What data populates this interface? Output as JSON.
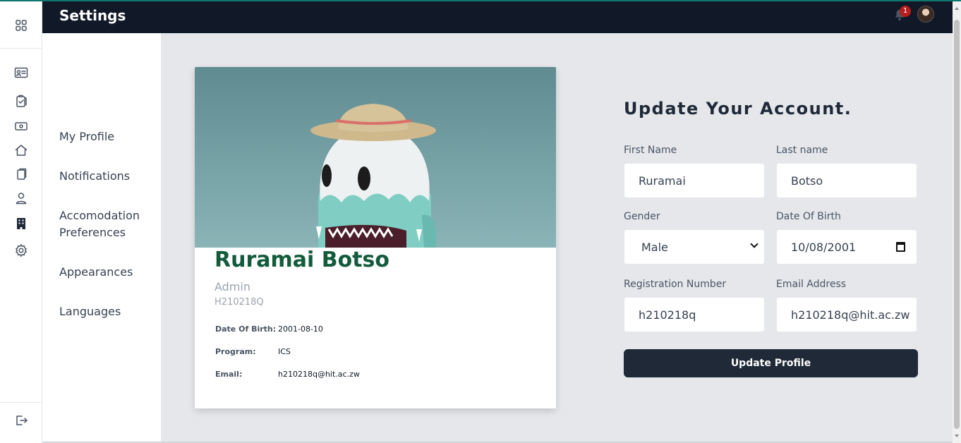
{
  "header": {
    "title": "Settings",
    "notification_count": "1"
  },
  "menu": {
    "items": [
      {
        "label": "My Profile"
      },
      {
        "label": "Notifications"
      },
      {
        "label": "Accomodation Preferences"
      },
      {
        "label": "Appearances"
      },
      {
        "label": "Languages"
      }
    ]
  },
  "rail_icons": [
    "grid-icon",
    "id-card-icon",
    "clipboard-check-icon",
    "cash-icon",
    "home-icon",
    "documents-icon",
    "user-icon",
    "building-icon",
    "gear-icon",
    "logout-icon"
  ],
  "profile": {
    "name": "Ruramai Botso",
    "role": "Admin",
    "reg_number": "H210218Q",
    "details": [
      {
        "label": "Date Of Birth:",
        "value": "2001-08-10"
      },
      {
        "label": "Program:",
        "value": "ICS"
      },
      {
        "label": "Email:",
        "value": "h210218q@hit.ac.zw"
      }
    ]
  },
  "form": {
    "title": "Update Your Account.",
    "first_name": {
      "label": "First Name",
      "value": "Ruramai"
    },
    "last_name": {
      "label": "Last name",
      "value": "Botso"
    },
    "gender": {
      "label": "Gender",
      "value": "Male"
    },
    "dob": {
      "label": "Date Of Birth",
      "value": "10/08/2001"
    },
    "reg": {
      "label": "Registration Number",
      "value": "h210218q"
    },
    "email": {
      "label": "Email Address",
      "value": "h210218q@hit.ac.zw"
    },
    "submit_label": "Update Profile"
  },
  "colors": {
    "header_bg": "#111827",
    "accent_green": "#125c3c",
    "button_bg": "#1f2937",
    "badge": "#b91c1c"
  }
}
